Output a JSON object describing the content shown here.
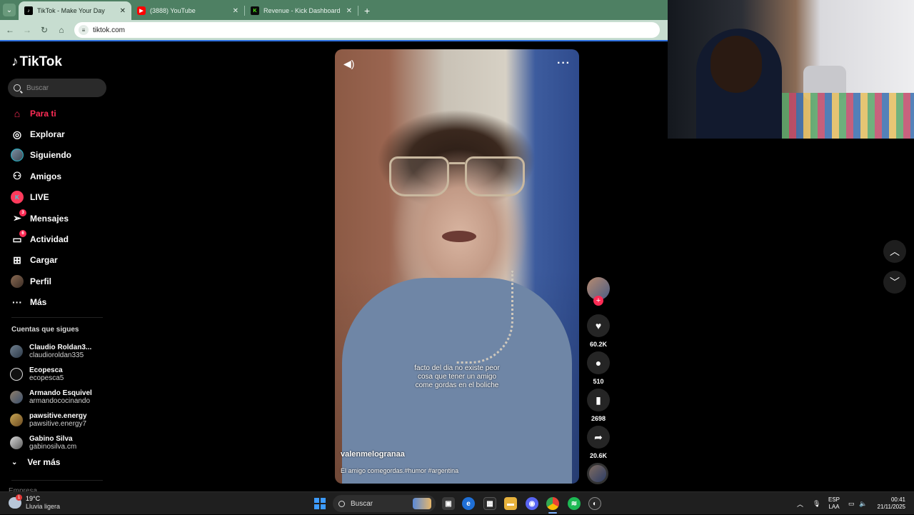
{
  "browser": {
    "tabs": [
      {
        "title": "TikTok - Make Your Day",
        "active": true,
        "favicon": "tiktok-icon"
      },
      {
        "title": "(3888) YouTube",
        "active": false,
        "favicon": "youtube-icon"
      },
      {
        "title": "Revenue - Kick Dashboard",
        "active": false,
        "favicon": "kick-icon"
      }
    ],
    "url": "tiktok.com",
    "colors": {
      "tabbar": "#4e8063",
      "toolbar": "#c7ddd0"
    }
  },
  "sidebar": {
    "logo": "TikTok",
    "search_placeholder": "Buscar",
    "nav": [
      {
        "label": "Para ti",
        "icon": "home-icon",
        "active": true
      },
      {
        "label": "Explorar",
        "icon": "compass-icon"
      },
      {
        "label": "Siguiendo",
        "icon": "following-avatar-icon"
      },
      {
        "label": "Amigos",
        "icon": "friends-icon"
      },
      {
        "label": "LIVE",
        "icon": "live-icon"
      },
      {
        "label": "Mensajes",
        "icon": "send-icon",
        "badge": "3"
      },
      {
        "label": "Actividad",
        "icon": "inbox-icon",
        "badge": "6"
      },
      {
        "label": "Cargar",
        "icon": "upload-icon"
      },
      {
        "label": "Perfil",
        "icon": "profile-avatar-icon"
      },
      {
        "label": "Más",
        "icon": "more-icon"
      }
    ],
    "following_title": "Cuentas que sigues",
    "following": [
      {
        "name": "Claudio Roldan3...",
        "user": "claudioroldan335"
      },
      {
        "name": "Ecopesca",
        "user": "ecopesca5"
      },
      {
        "name": "Armando Esquivel",
        "user": "armandococinando"
      },
      {
        "name": "pawsitive.energy",
        "user": "pawsitive.energy7"
      },
      {
        "name": "Gabino Silva",
        "user": "gabinosilva.cm"
      }
    ],
    "see_more": "Ver más",
    "cut_text": "Empresa"
  },
  "video": {
    "caption_lines": [
      "facto del dia no existe peor",
      "cosa que tener un amigo",
      "come gordas en el boliche"
    ],
    "author": "valenmelogranaa",
    "description": "El amigo comegordas.#humor #argentina"
  },
  "actions": {
    "likes": "60.2K",
    "comments": "510",
    "saves": "2698",
    "shares": "20.6K",
    "accent": "#fe2c55"
  },
  "taskbar": {
    "temperature": "19°C",
    "weather": "Lluvia ligera",
    "weather_badge": "1",
    "search_placeholder": "Buscar",
    "lang_line1": "ESP",
    "lang_line2": "LAA",
    "time": "00:41",
    "date": "21/11/2025"
  }
}
